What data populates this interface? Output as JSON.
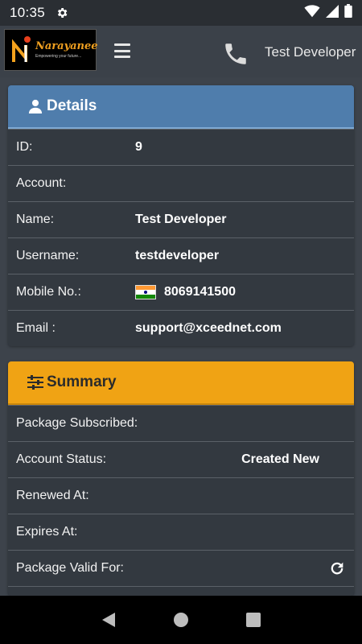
{
  "status_bar": {
    "time": "10:35"
  },
  "header": {
    "logo": {
      "name": "Narayanee",
      "tagline": "Empowering your future..."
    },
    "user_name": "Test Developer"
  },
  "details": {
    "title": "Details",
    "rows": [
      {
        "label": "ID:",
        "value": "9"
      },
      {
        "label": "Account:",
        "value": ""
      },
      {
        "label": "Name:",
        "value": "Test Developer"
      },
      {
        "label": "Username:",
        "value": "testdeveloper"
      },
      {
        "label": "Mobile No.:",
        "value": "8069141500"
      },
      {
        "label": "Email :",
        "value": "support@xceednet.com"
      }
    ]
  },
  "summary": {
    "title": "Summary",
    "rows": [
      {
        "label": "Package Subscribed:",
        "value": ""
      },
      {
        "label": "Account Status:",
        "value": "Created New"
      },
      {
        "label": "Renewed At:",
        "value": ""
      },
      {
        "label": "Expires At:",
        "value": ""
      },
      {
        "label": "Package Valid For:",
        "value": ""
      }
    ]
  },
  "colors": {
    "details_header": "#4f7dac",
    "summary_header": "#f0a314",
    "background": "#3d434b",
    "card": "#333940"
  }
}
